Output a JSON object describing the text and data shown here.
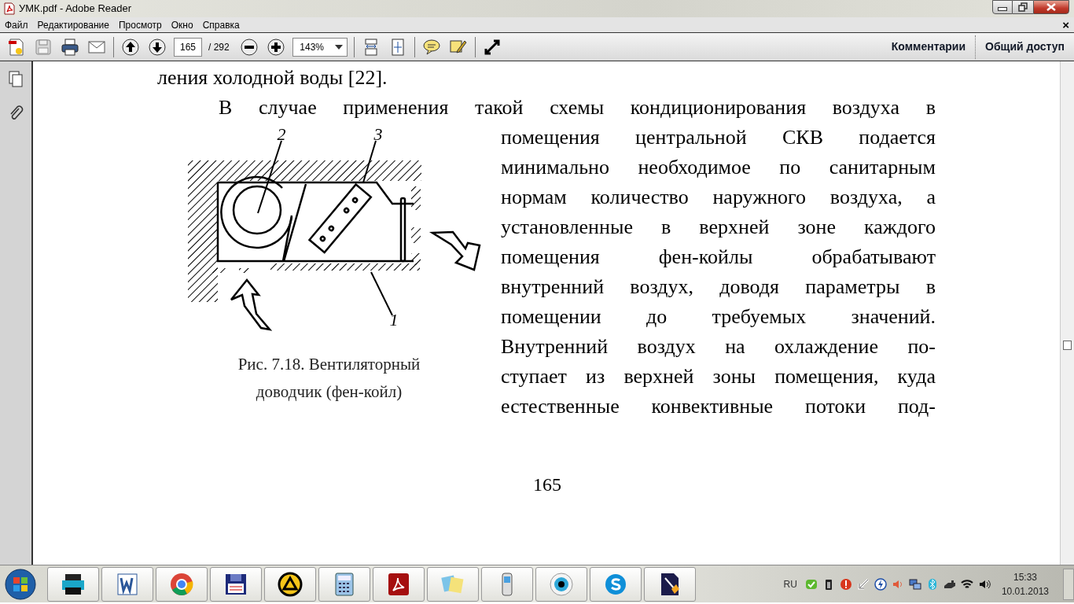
{
  "window": {
    "title": "УМК.pdf - Adobe Reader"
  },
  "menu": {
    "items": [
      "Файл",
      "Редактирование",
      "Просмотр",
      "Окно",
      "Справка"
    ],
    "close_label": "×"
  },
  "toolbar": {
    "groups": [
      [
        {
          "kind": "create"
        },
        {
          "kind": "save"
        },
        {
          "kind": "print"
        },
        {
          "kind": "mail"
        }
      ],
      [
        {
          "kind": "prev"
        },
        {
          "kind": "next"
        },
        {
          "kind": "pageinput"
        },
        {
          "kind": "zoomout"
        },
        {
          "kind": "zoomin"
        },
        {
          "kind": "zoominput"
        }
      ],
      [
        {
          "kind": "fitpage"
        },
        {
          "kind": "fitwindow"
        }
      ],
      [
        {
          "kind": "comment"
        },
        {
          "kind": "sign"
        }
      ],
      [
        {
          "kind": "fullscreen"
        }
      ]
    ],
    "page_number": "165",
    "page_total": "/ 292",
    "zoom": "143%",
    "tabs": [
      "Комментарии",
      "Общий доступ"
    ]
  },
  "sidebar": {
    "items": [
      {
        "kind": "pages"
      },
      {
        "kind": "attachments"
      }
    ]
  },
  "document": {
    "top_line": "ления холодной воды [22].",
    "first_line": "В случае применения такой схемы кондиционирования воздуха в",
    "column_lines": [
      "помещения центральной СКВ подается",
      "минимально необходимое по санитарным",
      "нормам количество наружного воздуха, а",
      "установленные в верхней зоне каждого",
      "помещения фен-койлы обрабатывают",
      "внутренний воздух, доводя параметры в",
      "помещении до требуемых значений.",
      "Внутренний воздух на охлаждение по-",
      "ступает из верхней зоны помещения, куда",
      "естественные конвективные потоки под-"
    ],
    "figure": {
      "labels": [
        "2",
        "3",
        "1"
      ],
      "caption": [
        "Рис. 7.18. Вентиляторный",
        "доводчик (фен-койл)"
      ]
    },
    "page_number": "165"
  },
  "taskbar": {
    "apps": [
      {
        "kind": "printer"
      },
      {
        "kind": "word"
      },
      {
        "kind": "chrome"
      },
      {
        "kind": "floppy"
      },
      {
        "kind": "triangle"
      },
      {
        "kind": "calculator"
      },
      {
        "kind": "acrobat"
      },
      {
        "kind": "folders"
      },
      {
        "kind": "phone"
      },
      {
        "kind": "eye"
      },
      {
        "kind": "skype"
      },
      {
        "kind": "paper"
      }
    ],
    "language": "RU",
    "tray": [
      {
        "kind": "check"
      },
      {
        "kind": "battery"
      },
      {
        "kind": "alert"
      },
      {
        "kind": "arrow"
      },
      {
        "kind": "bolt"
      },
      {
        "kind": "speaker"
      },
      {
        "kind": "network"
      },
      {
        "kind": "bluetooth"
      },
      {
        "kind": "drive"
      },
      {
        "kind": "wifi"
      },
      {
        "kind": "volume"
      }
    ],
    "time": "15:33",
    "date": "10.01.2013"
  }
}
